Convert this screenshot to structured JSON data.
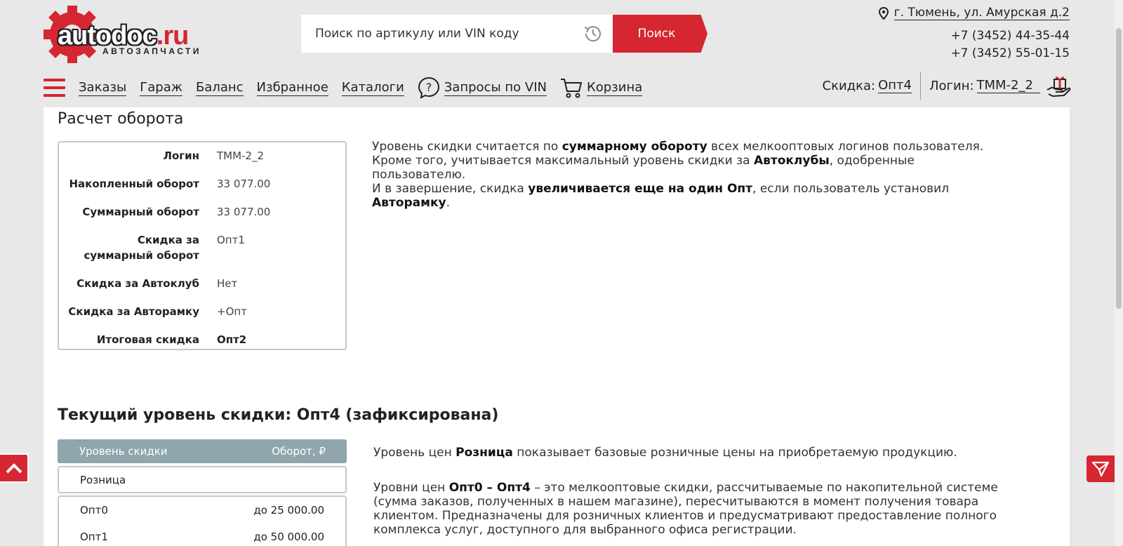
{
  "header": {
    "logo_word_dark": "autodoc",
    "logo_word_red": ".ru",
    "logo_sub": "АВТОЗАПЧАСТИ",
    "search_placeholder": "Поиск по артикулу или VIN коду",
    "search_button": "Поиск",
    "address": "г. Тюмень, ул. Амурская д.2",
    "phone1": "+7 (3452) 44-35-44",
    "phone2": "+7 (3452) 55-01-15"
  },
  "nav": {
    "orders": "Заказы",
    "garage": "Гараж",
    "balance": "Баланс",
    "favorites": "Избранное",
    "catalogs": "Каталоги",
    "vin_requests": "Запросы по VIN",
    "cart": "Корзина",
    "discount_label": "Скидка:",
    "discount_value": "Опт4",
    "login_label": "Логин:",
    "login_value": "TMM-2_2"
  },
  "turnover": {
    "title": "Расчет оборота",
    "rows": [
      {
        "key": "Логин",
        "value": "TMM-2_2"
      },
      {
        "key": "Накопленный оборот",
        "value": "33 077.00"
      },
      {
        "key": "Суммарный оборот",
        "value": "33 077.00"
      },
      {
        "key": "Скидка за суммарный оборот",
        "value": "Опт1"
      },
      {
        "key": "Скидка за Автоклуб",
        "value": "Нет"
      },
      {
        "key": "Скидка за Авторамку",
        "value": "+Опт"
      },
      {
        "key": "Итоговая скидка",
        "value": "Опт2"
      }
    ],
    "explain": {
      "l1_a": "Уровень скидки считается по ",
      "l1_b": "суммарному обороту",
      "l1_c": " всех мелкооптовых логинов пользователя.",
      "l2_a": "Кроме того, учитывается максимальный уровень скидки за ",
      "l2_b": "Автоклубы",
      "l2_c": ", одобренные пользователю.",
      "l3_a": "И в завершение, скидка ",
      "l3_b": "увеличивается еще на один Опт",
      "l3_c": ", если пользователь установил ",
      "l3_d": "Авторамку",
      "l3_e": "."
    }
  },
  "levels": {
    "title_prefix": "Текущий уровень скидки: ",
    "title_value": "Опт4 (зафиксирована)",
    "head_level": "Уровень скидки",
    "head_turnover": "Оборот, ₽",
    "retail": "Розница",
    "rows": [
      {
        "name": "Опт0",
        "limit": "до 25 000.00"
      },
      {
        "name": "Опт1",
        "limit": "до 50 000.00"
      }
    ],
    "text1_a": "Уровень цен ",
    "text1_b": "Розница",
    "text1_c": " показывает базовые розничные цены на приобретаемую продукцию.",
    "text2_a": "Уровни цен ",
    "text2_b": "Опт0 – Опт4",
    "text2_c": " – это мелкооптовые скидки, рассчитываемые по накопительной системе (сумма заказов, полученных в нашем магазине), пересчитываются в момент получения товара клиентом. Предназначены для розничных клиентов и предусматривают предоставление полного комплекса услуг, доступного для выбранного офиса регистрации."
  },
  "colors": {
    "brand_red": "#d62632",
    "table_header": "#8fa6ad"
  }
}
